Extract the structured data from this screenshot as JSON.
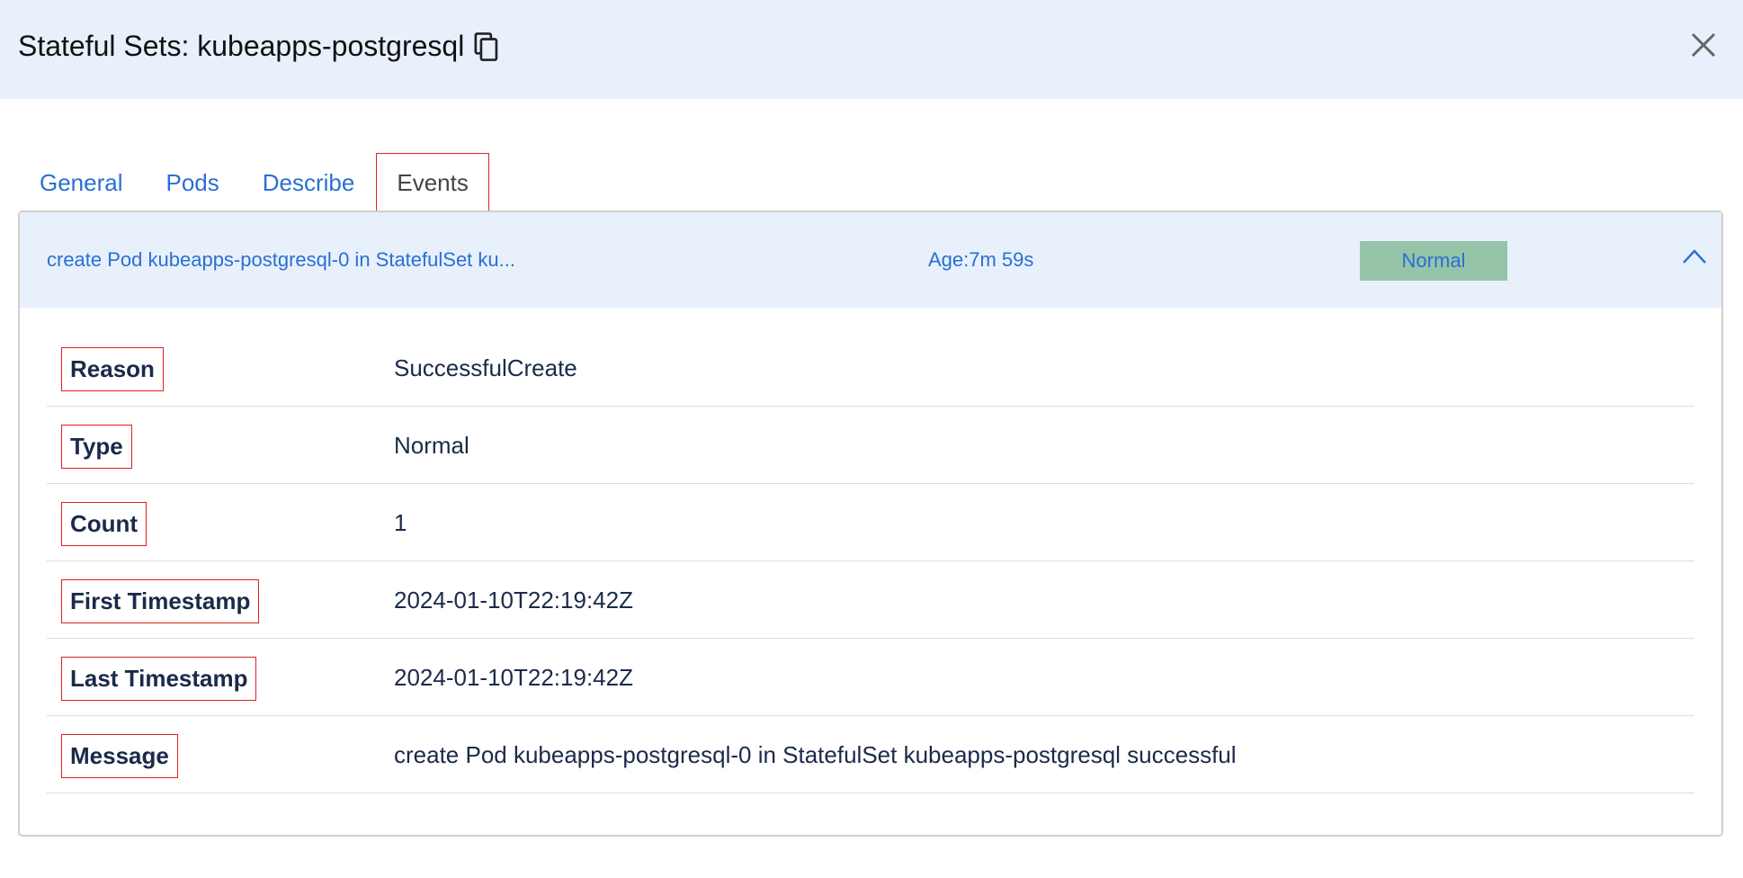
{
  "header": {
    "title": "Stateful Sets: kubeapps-postgresql",
    "copy_icon": "copy-icon",
    "close_icon": "close-icon"
  },
  "tabs": [
    {
      "label": "General",
      "active": false
    },
    {
      "label": "Pods",
      "active": false
    },
    {
      "label": "Describe",
      "active": false
    },
    {
      "label": "Events",
      "active": true
    }
  ],
  "event": {
    "summary_message": "create Pod kubeapps-postgresql-0 in StatefulSet ku...",
    "age": "Age:7m 59s",
    "type_badge": "Normal",
    "badge_color": "#95c4a9",
    "expand_icon": "chevron-up-icon",
    "details": [
      {
        "label": "Reason",
        "value": "SuccessfulCreate"
      },
      {
        "label": "Type",
        "value": "Normal"
      },
      {
        "label": "Count",
        "value": "1"
      },
      {
        "label": "First Timestamp",
        "value": "2024-01-10T22:19:42Z"
      },
      {
        "label": "Last Timestamp",
        "value": "2024-01-10T22:19:42Z"
      },
      {
        "label": "Message",
        "value": "create Pod kubeapps-postgresql-0 in StatefulSet kubeapps-postgresql successful"
      }
    ]
  },
  "colors": {
    "header_bg": "#e8f0fc",
    "link_blue": "#2a6fd3",
    "label_text": "#1b2a4a",
    "highlight_border": "#e02020"
  }
}
